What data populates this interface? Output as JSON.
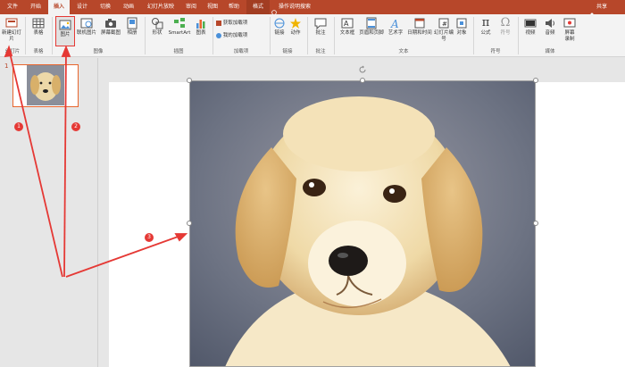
{
  "tabs": [
    "文件",
    "开始",
    "插入",
    "设计",
    "切换",
    "动画",
    "幻灯片放映",
    "审阅",
    "视图",
    "帮助",
    "格式"
  ],
  "active_tab_index": 2,
  "tell_me": "操作说明搜索",
  "share": "共享",
  "ribbon": {
    "new_slide": "新建幻灯片",
    "table": "表格",
    "picture": "图片",
    "online_picture": "联机图片",
    "screenshot": "屏幕截图",
    "album": "相册",
    "shapes": "形状",
    "smartart": "SmartArt",
    "chart": "图表",
    "get_addins": "获取加载项",
    "my_addins": "我的加载项",
    "link": "链接",
    "action": "动作",
    "comment": "批注",
    "textbox": "文本框",
    "header_footer": "页眉和页脚",
    "wordart": "艺术字",
    "datetime": "日期和时间",
    "slide_number": "幻灯片编号",
    "object": "对象",
    "equation": "公式",
    "symbol": "符号",
    "video": "视频",
    "audio": "音频",
    "screen_record": "屏幕录制"
  },
  "groups": {
    "slides": "幻灯片",
    "tables": "表格",
    "images": "图像",
    "illustrations": "插图",
    "addins": "加载项",
    "links": "链接",
    "comments": "批注",
    "text": "文本",
    "symbols": "符号",
    "media": "媒体"
  },
  "thumb_number": "1",
  "badges": [
    "1",
    "2",
    "3"
  ],
  "colors": {
    "accent": "#b7472a",
    "annotation": "#e53935"
  }
}
